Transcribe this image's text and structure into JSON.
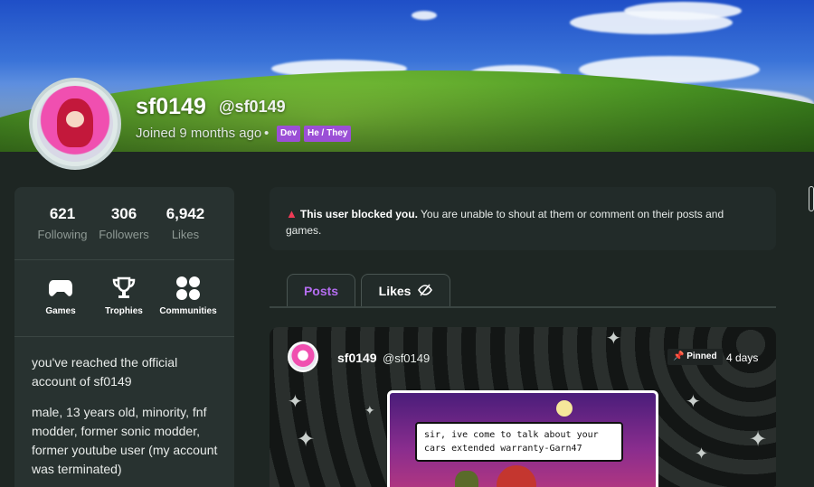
{
  "profile": {
    "username": "sf0149",
    "handle": "@sf0149",
    "joined": "Joined 9 months ago",
    "separator": "•",
    "badges": [
      "Dev",
      "He / They"
    ]
  },
  "stats": [
    {
      "value": "621",
      "label": "Following"
    },
    {
      "value": "306",
      "label": "Followers"
    },
    {
      "value": "6,942",
      "label": "Likes"
    }
  ],
  "nav": [
    {
      "label": "Games",
      "icon": "gamepad-icon"
    },
    {
      "label": "Trophies",
      "icon": "trophy-icon"
    },
    {
      "label": "Communities",
      "icon": "communities-icon"
    }
  ],
  "bio": {
    "paragraph1": "you've reached the official account of sf0149",
    "paragraph2": "male, 13 years old, minority, fnf modder, former sonic modder, former youtube user (my account was terminated)"
  },
  "blocked_notice": {
    "title": "This user blocked you.",
    "message": "You are unable to shout at them or comment on their posts and games."
  },
  "tabs": [
    {
      "label": "Posts",
      "active": true
    },
    {
      "label": "Likes",
      "icon": "eye-slash-icon"
    }
  ],
  "post": {
    "author": "sf0149",
    "handle": "@sf0149",
    "pinned_label": "Pinned",
    "time": "4 days",
    "image_caption": "sir, ive come to talk about your cars extended warranty-Garn47"
  },
  "colors": {
    "accent_purple": "#b46df0",
    "badge_purple": "#9b4fd6",
    "warning_red": "#ef3b56",
    "panel_bg": "#283230",
    "page_bg": "#1e2623"
  }
}
